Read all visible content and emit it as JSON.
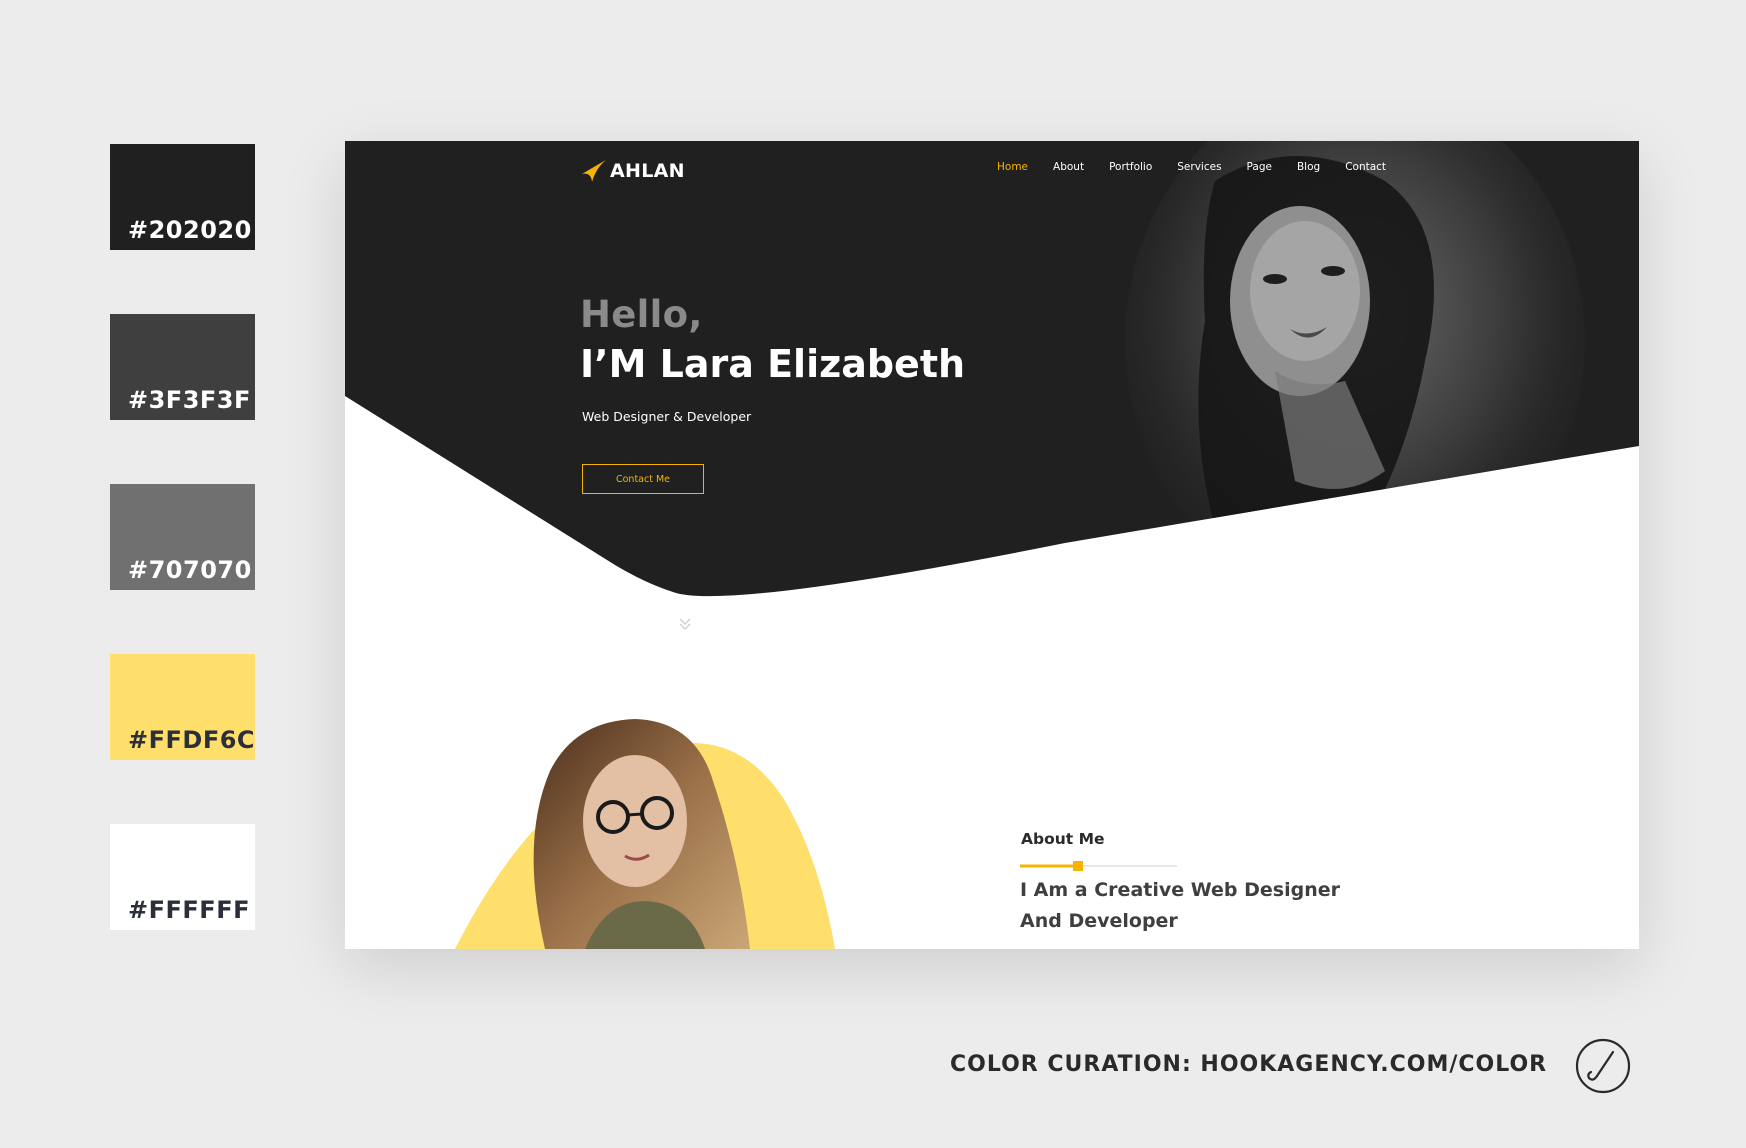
{
  "palette": [
    {
      "hex": "#202020",
      "label": "#202020",
      "text_color": "#ffffff"
    },
    {
      "hex": "#3F3F3F",
      "label": "#3F3F3F",
      "text_color": "#ffffff"
    },
    {
      "hex": "#707070",
      "label": "#707070",
      "text_color": "#ffffff"
    },
    {
      "hex": "#FFDF6C",
      "label": "#FFDF6C",
      "text_color": "#2a2f3a"
    },
    {
      "hex": "#FFFFFF",
      "label": "#FFFFFF",
      "text_color": "#2a2f3a"
    }
  ],
  "site": {
    "brand": "AHLAN",
    "nav": [
      "Home",
      "About",
      "Portfolio",
      "Services",
      "Page",
      "Blog",
      "Contact"
    ],
    "active_nav": "Home",
    "hero": {
      "greeting": "Hello,",
      "name": "I’M Lara Elizabeth",
      "role": "Web Designer & Developer",
      "cta": "Contact Me"
    },
    "about": {
      "label": "About Me",
      "heading_line1": "I Am a Creative Web Designer",
      "heading_line2": "And Developer"
    }
  },
  "colors": {
    "dark": "#202020",
    "accent": "#f5b400",
    "yellow": "#FFDF6C",
    "white": "#ffffff"
  },
  "icons": {
    "logo_swoosh": "logo-swoosh-icon",
    "scroll_down": "double-chevron-down-icon",
    "credit_mark": "hook-agency-icon"
  },
  "credit": "COLOR CURATION: HOOKAGENCY.COM/COLOR"
}
